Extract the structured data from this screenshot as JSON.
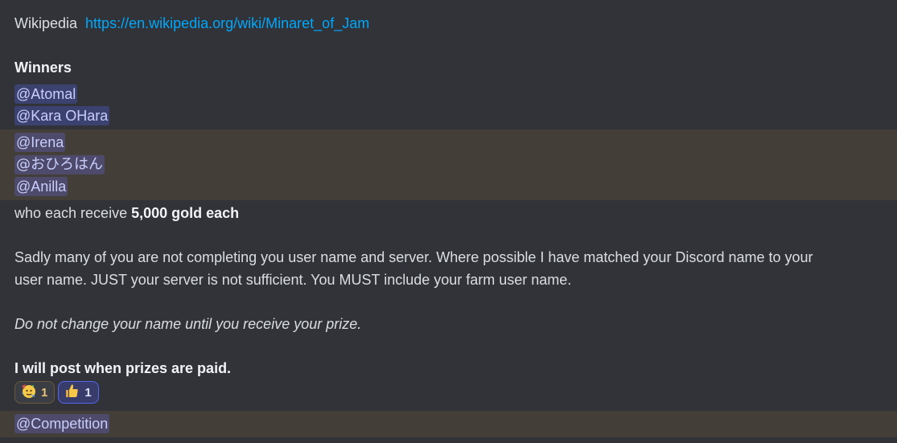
{
  "wiki": {
    "label": "Wikipedia",
    "url": "https://en.wikipedia.org/wiki/Minaret_of_Jam"
  },
  "winners": {
    "heading": "Winners",
    "mentions": [
      "@Atomal",
      "@Kara OHara",
      "@Irena",
      "@おひろはん",
      "@Anilla"
    ]
  },
  "receive": {
    "prefix": "who each receive ",
    "amount": "5,000 gold each"
  },
  "notice": {
    "line1": "Sadly many of you are not completing you user name and server. Where possible I have matched your Discord name to your",
    "line2": "user name. JUST your server is not sufficient. You MUST include your farm user name."
  },
  "italic_note": "Do not change your name until you receive your prize.",
  "post_note": "I will post when prizes are paid.",
  "reactions": [
    {
      "icon": "partying-face-icon",
      "count": "1"
    },
    {
      "icon": "thumbs-up-icon",
      "count": "1"
    }
  ],
  "role_mention": "@Competition",
  "colors": {
    "background": "#313338",
    "highlight": "#433f38",
    "link": "#00a8fc",
    "mention_bg": "#3c4270",
    "mention_text": "#c9cdfb"
  }
}
